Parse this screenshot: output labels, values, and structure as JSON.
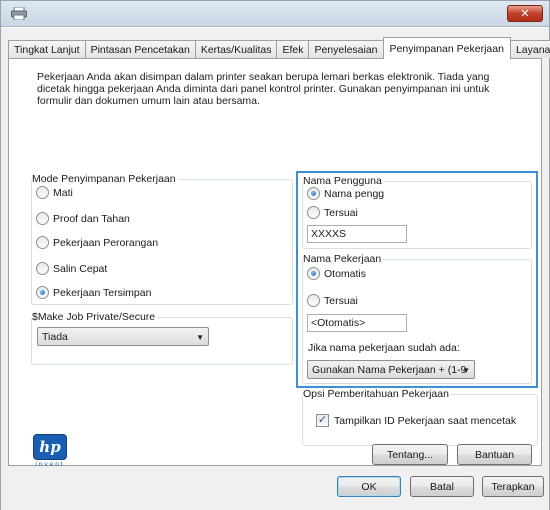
{
  "window": {
    "close_label": "✕"
  },
  "tabs": [
    {
      "label": "Tingkat Lanjut"
    },
    {
      "label": "Pintasan Pencetakan"
    },
    {
      "label": "Kertas/Kualitas"
    },
    {
      "label": "Efek"
    },
    {
      "label": "Penyelesaian"
    },
    {
      "label": "Penyimpanan Pekerjaan",
      "active": true
    },
    {
      "label": "Layanan"
    }
  ],
  "intro_text": "Pekerjaan Anda akan disimpan dalam printer seakan berupa lemari berkas elektronik. Tiada yang dicetak hingga pekerjaan Anda diminta dari panel kontrol printer. Gunakan penyimpanan ini untuk formulir dan dokumen umum lain atau bersama.",
  "mode_group": {
    "legend": "Mode Penyimpanan Pekerjaan",
    "options": [
      {
        "label": "Mati",
        "selected": false
      },
      {
        "label": "Proof dan Tahan",
        "selected": false
      },
      {
        "label": "Pekerjaan Perorangan",
        "selected": false
      },
      {
        "label": "Salin Cepat",
        "selected": false
      },
      {
        "label": "Pekerjaan Tersimpan",
        "selected": true
      }
    ]
  },
  "private_group": {
    "legend": "$Make Job Private/Secure",
    "selected": "Tiada"
  },
  "user_group": {
    "legend": "Nama Pengguna",
    "option_default": "Nama pengg",
    "option_custom": "Tersuai",
    "value": "XXXXS"
  },
  "job_group": {
    "legend": "Nama Pekerjaan",
    "option_auto": "Otomatis",
    "option_custom": "Tersuai",
    "value": "<Otomatis>",
    "exists_label": "Jika nama pekerjaan sudah ada:",
    "exists_selected": "Gunakan Nama Pekerjaan + (1-9"
  },
  "notify_group": {
    "legend": "Opsi Pemberitahuan Pekerjaan",
    "checkbox_label": "Tampilkan ID Pekerjaan saat mencetak",
    "checked": true
  },
  "logo": {
    "text": "hp",
    "tagline": "invent"
  },
  "buttons": {
    "about": "Tentang...",
    "help": "Bantuan",
    "ok": "OK",
    "cancel": "Batal",
    "apply": "Terapkan"
  },
  "icons": {
    "title": "printer-icon",
    "close": "close-icon",
    "dropdown": "chevron-down-icon",
    "check": "checkmark-icon"
  },
  "colors": {
    "accent": "#1a5fb4",
    "highlight_border": "#3d8fd6",
    "close_button": "#c2402a"
  }
}
